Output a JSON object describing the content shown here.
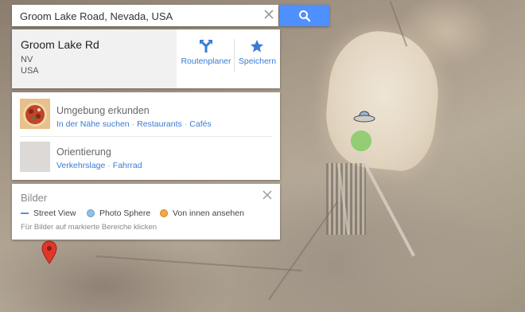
{
  "search": {
    "value": "Groom Lake Road, Nevada, USA"
  },
  "place": {
    "title": "Groom Lake Rd",
    "line1": "NV",
    "line2": "USA",
    "directions_label": "Routenplaner",
    "save_label": "Speichern"
  },
  "explore": {
    "nearby": {
      "title": "Umgebung erkunden",
      "links": [
        "In der Nähe suchen",
        "Restaurants",
        "Cafés"
      ]
    },
    "orientation": {
      "title": "Orientierung",
      "links": [
        "Verkehrslage",
        "Fahrrad"
      ]
    }
  },
  "images": {
    "title": "Bilder",
    "legend": [
      "Street View",
      "Photo Sphere",
      "Von innen ansehen"
    ],
    "hint": "Für Bilder auf markierte Bereiche klicken"
  },
  "colors": {
    "accent": "#4d90fe",
    "link": "#3a7bd5",
    "street_view": "#5b8fd6",
    "photo_sphere": "#8ec3e6",
    "inside_view": "#f4a742",
    "marker_green": "#8fcf6e",
    "pin_red": "#e0362c"
  }
}
